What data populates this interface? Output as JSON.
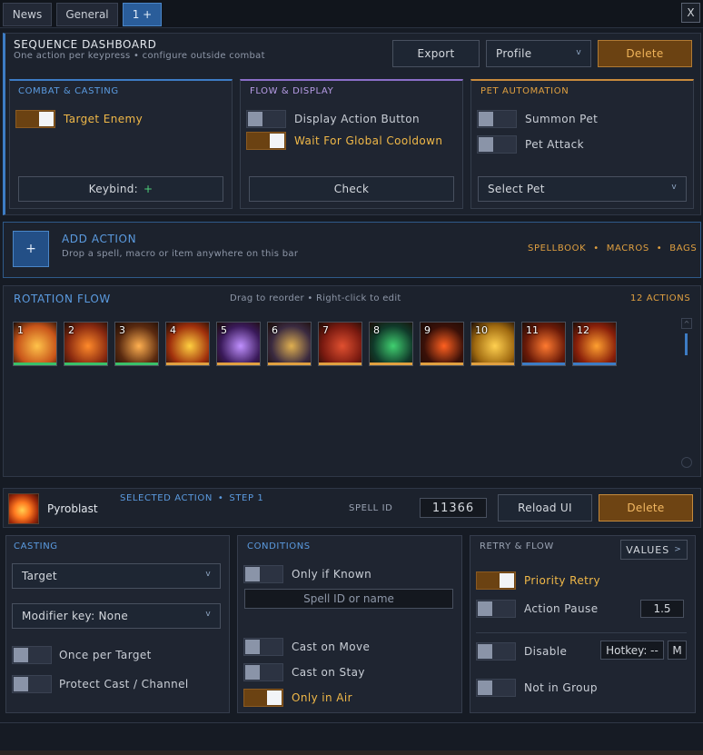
{
  "tabs": [
    {
      "label": "News"
    },
    {
      "label": "General"
    },
    {
      "label": "1 +"
    }
  ],
  "close_label": "X",
  "header": {
    "title": "SEQUENCE DASHBOARD",
    "subtitle": "One action per keypress  •  configure outside combat",
    "export_label": "Export",
    "profile_label": "Profile",
    "delete_label": "Delete"
  },
  "combat": {
    "title": "COMBAT & CASTING",
    "target_enemy": "Target Enemy",
    "keybind_label": "Keybind:",
    "keybind_plus": "+"
  },
  "flow": {
    "title": "FLOW & DISPLAY",
    "display_action": "Display Action Button",
    "wait_gcd": "Wait For Global Cooldown",
    "check_label": "Check"
  },
  "pet": {
    "title": "PET AUTOMATION",
    "summon": "Summon Pet",
    "attack": "Pet Attack",
    "select_label": "Select Pet"
  },
  "add": {
    "plus": "+",
    "title": "ADD ACTION",
    "subtitle": "Drop a spell, macro or item anywhere on this bar",
    "spellbook": "SPELLBOOK",
    "macros": "MACROS",
    "bags": "BAGS",
    "dot": "•"
  },
  "rotation": {
    "title": "ROTATION FLOW",
    "hint": "Drag to reorder  •  Right-click to edit",
    "count": "12 ACTIONS",
    "slots": [
      {
        "num": "1",
        "bar": "#3ac06a",
        "bg": "#c8551a",
        "fg": "#ffc34a"
      },
      {
        "num": "2",
        "bar": "#3ac06a",
        "bg": "#8a2a10",
        "fg": "#ff8a2a"
      },
      {
        "num": "3",
        "bar": "#3ac06a",
        "bg": "#5a2a10",
        "fg": "#ffb050"
      },
      {
        "num": "4",
        "bar": "#e0a040",
        "bg": "#a0300c",
        "fg": "#ffd040"
      },
      {
        "num": "5",
        "bar": "#e0a040",
        "bg": "#3a1a5a",
        "fg": "#c090ff"
      },
      {
        "num": "6",
        "bar": "#e0a040",
        "bg": "#3a2a40",
        "fg": "#e0b050"
      },
      {
        "num": "7",
        "bar": "#e0a040",
        "bg": "#7a1a10",
        "fg": "#e05030"
      },
      {
        "num": "8",
        "bar": "#e0a040",
        "bg": "#103a2a",
        "fg": "#40d070"
      },
      {
        "num": "9",
        "bar": "#e0a040",
        "bg": "#3a1008",
        "fg": "#ff6020"
      },
      {
        "num": "10",
        "bar": "#e0a040",
        "bg": "#a06a10",
        "fg": "#ffd050"
      },
      {
        "num": "11",
        "bar": "#3d7cc4",
        "bg": "#6a1a08",
        "fg": "#ff7a30"
      },
      {
        "num": "12",
        "bar": "#3d7cc4",
        "bg": "#8a200a",
        "fg": "#ffa030"
      }
    ]
  },
  "selected": {
    "name": "Pyroblast",
    "tag": "SELECTED ACTION",
    "step": "STEP 1",
    "dot": "•",
    "spell_id_label": "SPELL ID",
    "spell_id": "11366",
    "reload_label": "Reload UI",
    "delete_label": "Delete"
  },
  "casting": {
    "title": "CASTING",
    "target_label": "Target",
    "modifier_label": "Modifier key: None",
    "once_per_target": "Once per Target",
    "protect_cast": "Protect Cast / Channel"
  },
  "conditions": {
    "title": "CONDITIONS",
    "only_if_known": "Only if Known",
    "spell_placeholder": "Spell ID or name",
    "cast_on_move": "Cast on Move",
    "cast_on_stay": "Cast on Stay",
    "only_in_air": "Only in Air"
  },
  "retry": {
    "title": "RETRY & FLOW",
    "values_label": "VALUES",
    "priority_retry": "Priority Retry",
    "action_pause": "Action Pause",
    "pause_value": "1.5",
    "disable": "Disable",
    "hotkey_label": "Hotkey: --",
    "hotkey_m": "M",
    "not_in_group": "Not in Group"
  },
  "colors": {
    "accent_blue": "#3d7cc4",
    "accent_orange": "#e0a040",
    "toggle_on": "#6b4212"
  }
}
